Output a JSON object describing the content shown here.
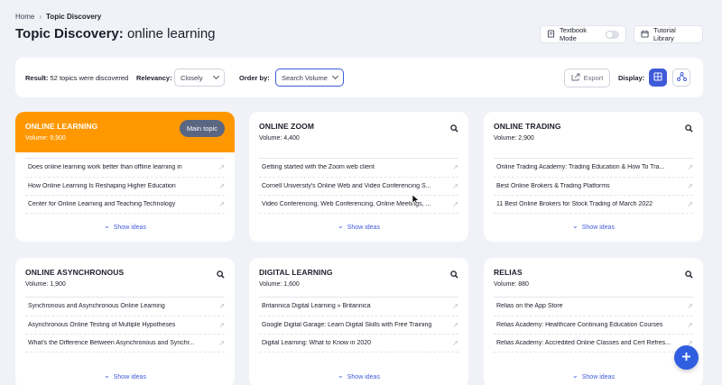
{
  "breadcrumb": {
    "home": "Home",
    "current": "Topic Discovery"
  },
  "page_title": {
    "prefix": "Topic Discovery:",
    "keyword": "online learning"
  },
  "header_actions": {
    "textbook_mode": "Textbook Mode",
    "textbook_mode_on": false,
    "tutorial_library": "Tutorial Library"
  },
  "filters": {
    "result_label": "Result:",
    "result_text": "52 topics were discovered",
    "relevancy_label": "Relevancy:",
    "relevancy_value": "Closely",
    "order_label": "Order by:",
    "order_value": "Search Volume",
    "export": "Export",
    "display_label": "Display:"
  },
  "cards": [
    {
      "title": "ONLINE LEARNING",
      "volume": "Volume: 9,900",
      "badge": "Main topic",
      "items": [
        "Does online learning work better than offline learning in",
        "How Online Learning Is Reshaping Higher Education",
        "Center for Online Learning and Teaching Technology"
      ],
      "show": "Show ideas"
    },
    {
      "title": "ONLINE ZOOM",
      "volume": "Volume: 4,400",
      "items": [
        "Getting started with the Zoom web client",
        "Cornell University's Online Web and Video Conferencing S...",
        "Video Conferencing, Web Conferencing, Online Meetings, ..."
      ],
      "show": "Show ideas"
    },
    {
      "title": "ONLINE TRADING",
      "volume": "Volume: 2,900",
      "items": [
        "Online Trading Academy: Trading Education & How To Tra...",
        "Best Online Brokers & Trading Platforms",
        "11 Best Online Brokers for Stock Trading of March 2022"
      ],
      "show": "Show ideas"
    },
    {
      "title": "ONLINE ASYNCHRONOUS",
      "volume": "Volume: 1,900",
      "items": [
        "Synchronous and Asynchronous Online Learning",
        "Asynchronous Online Testing of Multiple Hypotheses",
        "What's the Difference Between Asynchronous and Synchr..."
      ],
      "show": "Show ideas"
    },
    {
      "title": "DIGITAL LEARNING",
      "volume": "Volume: 1,600",
      "items": [
        "Britannica Digital Learning » Britannica",
        "Google Digital Garage: Learn Digital Skills with Free Training",
        "Digital Learning: What to Know in 2020"
      ],
      "show": "Show ideas"
    },
    {
      "title": "RELIAS",
      "volume": "Volume: 880",
      "items": [
        "Relias on the App Store",
        "Relias Academy: Healthcare Continuing Education Courses",
        "Relias Academy: Accredited Online Classes and Cert Refres..."
      ],
      "show": "Show ideas"
    }
  ],
  "colors": {
    "accent": "#3f5bd8",
    "main_card": "#ff9800",
    "badge": "#5a6682",
    "fab": "#2f5fe0"
  }
}
